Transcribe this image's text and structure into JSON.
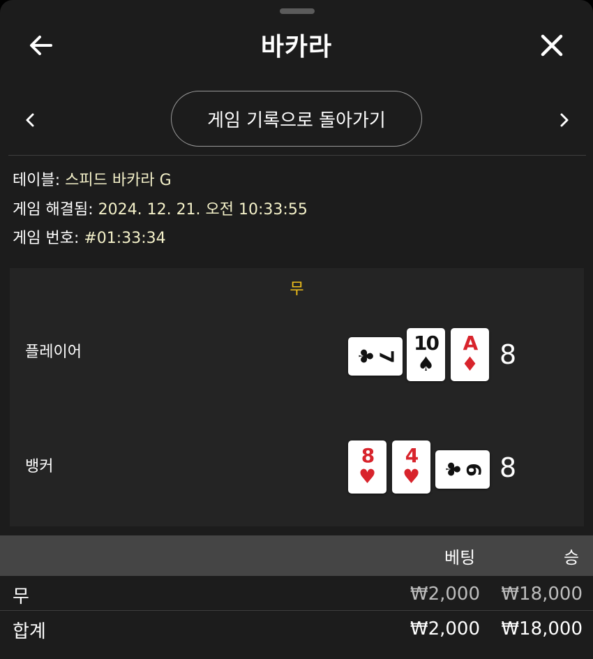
{
  "header": {
    "title": "바카라",
    "back_icon": "arrow-left-icon",
    "close_icon": "close-icon"
  },
  "nav": {
    "history_label": "게임 기록으로 돌아가기",
    "prev_icon": "chevron-left-icon",
    "next_icon": "chevron-right-icon"
  },
  "info": {
    "table_label": "테이블: ",
    "table_value": "스피드 바카라 G",
    "resolved_label": "게임 해결됨: ",
    "resolved_value": "2024. 12. 21. 오전 10:33:55",
    "game_no_label": "게임 번호: ",
    "game_no_value": "#01:33:34"
  },
  "result": {
    "outcome": "무",
    "player": {
      "label": "플레이어",
      "score": "8",
      "cards": [
        {
          "rank": "7",
          "suit": "♣",
          "color": "black",
          "orientation": "sideways"
        },
        {
          "rank": "10",
          "suit": "♠",
          "color": "black",
          "orientation": "upright"
        },
        {
          "rank": "A",
          "suit": "♦",
          "color": "red",
          "orientation": "upright"
        }
      ]
    },
    "banker": {
      "label": "뱅커",
      "score": "8",
      "cards": [
        {
          "rank": "8",
          "suit": "♥",
          "color": "red",
          "orientation": "upright"
        },
        {
          "rank": "4",
          "suit": "♥",
          "color": "red",
          "orientation": "upright"
        },
        {
          "rank": "6",
          "suit": "♣",
          "color": "black",
          "orientation": "sideways"
        }
      ]
    }
  },
  "table": {
    "headers": {
      "bet": "베팅",
      "win": "승"
    },
    "rows": [
      {
        "label": "무",
        "bet": "₩2,000",
        "win": "₩18,000"
      }
    ],
    "total": {
      "label": "합계",
      "bet": "₩2,000",
      "win": "₩18,000"
    }
  },
  "colors": {
    "background": "#1c1c1c",
    "panel": "#242424",
    "accent_outcome": "#f3c21b",
    "info_value": "#f4f1c9",
    "table_header": "#454545"
  }
}
